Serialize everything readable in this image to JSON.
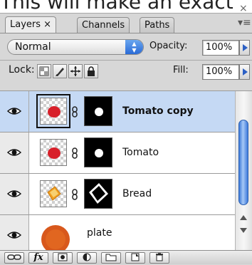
{
  "caption": {
    "text": "This will make an exact"
  },
  "tabs": [
    {
      "label": "Layers ×",
      "active": true
    },
    {
      "label": "Channels",
      "active": false
    },
    {
      "label": "Paths",
      "active": false
    }
  ],
  "panel": {
    "close_glyph": "×",
    "menu_glyph": "▾≡"
  },
  "blend": {
    "value": "Normal"
  },
  "opacity": {
    "label": "Opacity:",
    "value": "100%"
  },
  "lock": {
    "label": "Lock:"
  },
  "fill": {
    "label": "Fill:",
    "value": "100%"
  },
  "layers": [
    {
      "name": "Tomato copy",
      "selected": true,
      "thumb": "tomato",
      "mask": "dot"
    },
    {
      "name": "Tomato",
      "selected": false,
      "thumb": "tomato",
      "mask": "dot"
    },
    {
      "name": "Bread",
      "selected": false,
      "thumb": "bread",
      "mask": "square"
    },
    {
      "name": "plate",
      "selected": false,
      "thumb": "plate",
      "mask": null
    }
  ],
  "toolbar": {
    "link_icon": "link-layers-icon",
    "fx_label": "fx",
    "mask_icon": "add-mask-icon",
    "adjust_icon": "adjustment-layer-icon",
    "group_icon": "new-group-icon",
    "new_icon": "new-layer-icon",
    "trash_icon": "delete-layer-icon"
  },
  "colors": {
    "selection": "#c5d9f4",
    "accent_blue": "#2b5fc4",
    "tomato": "#d8202a",
    "bread": "#f0a020"
  }
}
